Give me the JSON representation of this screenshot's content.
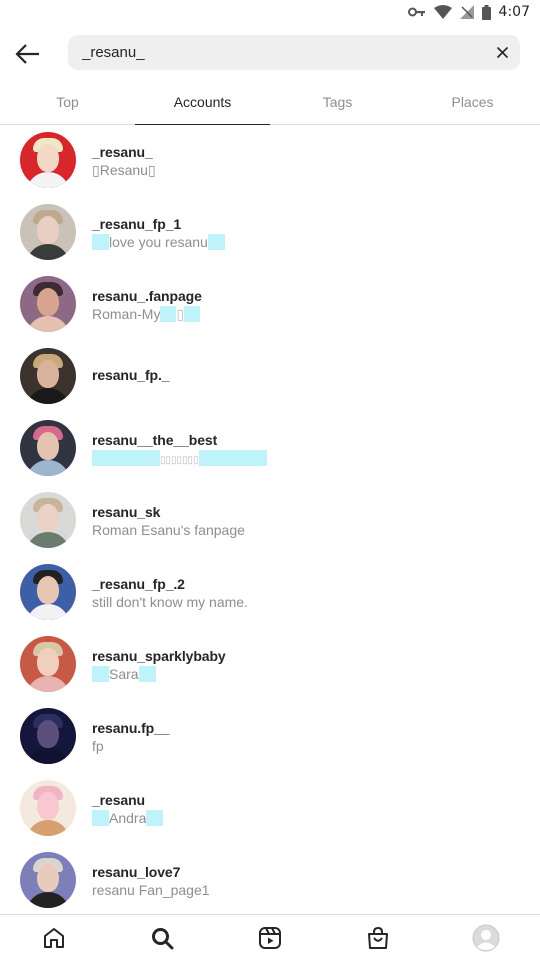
{
  "status_bar": {
    "time": "4:07",
    "icons": [
      "key-icon",
      "wifi-icon",
      "signal-icon",
      "battery-icon"
    ]
  },
  "search": {
    "query": "_resanu_",
    "back_icon": "arrow-left-icon",
    "clear_icon": "close-icon"
  },
  "tabs": [
    {
      "label": "Top",
      "active": false
    },
    {
      "label": "Accounts",
      "active": true
    },
    {
      "label": "Tags",
      "active": false
    },
    {
      "label": "Places",
      "active": false
    }
  ],
  "results": [
    {
      "username": "_resanu_",
      "full_name": "▯Resanu▯",
      "colors": {
        "bg": "#d8262b",
        "hair": "#f0e6c8",
        "face": "#f3d9c5",
        "body": "#f4f4f4"
      }
    },
    {
      "username": "_resanu_fp_1",
      "full_name": "love you resanu",
      "colors": {
        "bg": "#c9c2b8",
        "hair": "#bfa88c",
        "face": "#e8cfc1",
        "body": "#3b3b3b"
      }
    },
    {
      "username": "resanu_.fanpage",
      "full_name": "Roman-My",
      "colors": {
        "bg": "#8c6a86",
        "hair": "#3d2a33",
        "face": "#d7a58e",
        "body": "#e3c0b0"
      }
    },
    {
      "username": "resanu_fp._",
      "full_name": "",
      "colors": {
        "bg": "#3b332e",
        "hair": "#c9a977",
        "face": "#d9b39b",
        "body": "#1a1a1a"
      }
    },
    {
      "username": "resanu__the__best",
      "full_name": "▯▯▯▯▯▯▯",
      "colors": {
        "bg": "#2f3440",
        "hair": "#d86a8e",
        "face": "#e4c3b0",
        "body": "#9db6cf"
      }
    },
    {
      "username": "resanu_sk",
      "full_name": "Roman Esanu's fanpage",
      "colors": {
        "bg": "#d9d9d6",
        "hair": "#c7b49a",
        "face": "#ead3c4",
        "body": "#6b7c6e"
      }
    },
    {
      "username": "_resanu_fp_.2",
      "full_name": "still don't know my name.",
      "colors": {
        "bg": "#3d5fa8",
        "hair": "#222222",
        "face": "#e8c7b2",
        "body": "#f2f2f2"
      }
    },
    {
      "username": "resanu_sparklybaby",
      "full_name": "Sara",
      "colors": {
        "bg": "#c65a45",
        "hair": "#d8c7a3",
        "face": "#f0d0bd",
        "body": "#e9b4b0"
      }
    },
    {
      "username": "resanu.fp__",
      "full_name": "fp",
      "colors": {
        "bg": "#14163a",
        "hair": "#2c2e63",
        "face": "#5c4f7d",
        "body": "#101330"
      }
    },
    {
      "username": "_resanu",
      "full_name": "Andra",
      "colors": {
        "bg": "#f4e9de",
        "hair": "#f2b3c4",
        "face": "#f7c8d2",
        "body": "#d8a070"
      }
    },
    {
      "username": "resanu_love7",
      "full_name": "resanu Fan_page1",
      "colors": {
        "bg": "#7d7fb8",
        "hair": "#dad6cf",
        "face": "#e7cbbb",
        "body": "#222222"
      }
    }
  ],
  "bottom_nav": [
    "home-icon",
    "search-icon",
    "reels-icon",
    "shop-icon",
    "profile-avatar"
  ],
  "colors": {
    "highlight": "#bff3fb",
    "secondary_text": "#8e8e8e",
    "primary_text": "#262626"
  }
}
